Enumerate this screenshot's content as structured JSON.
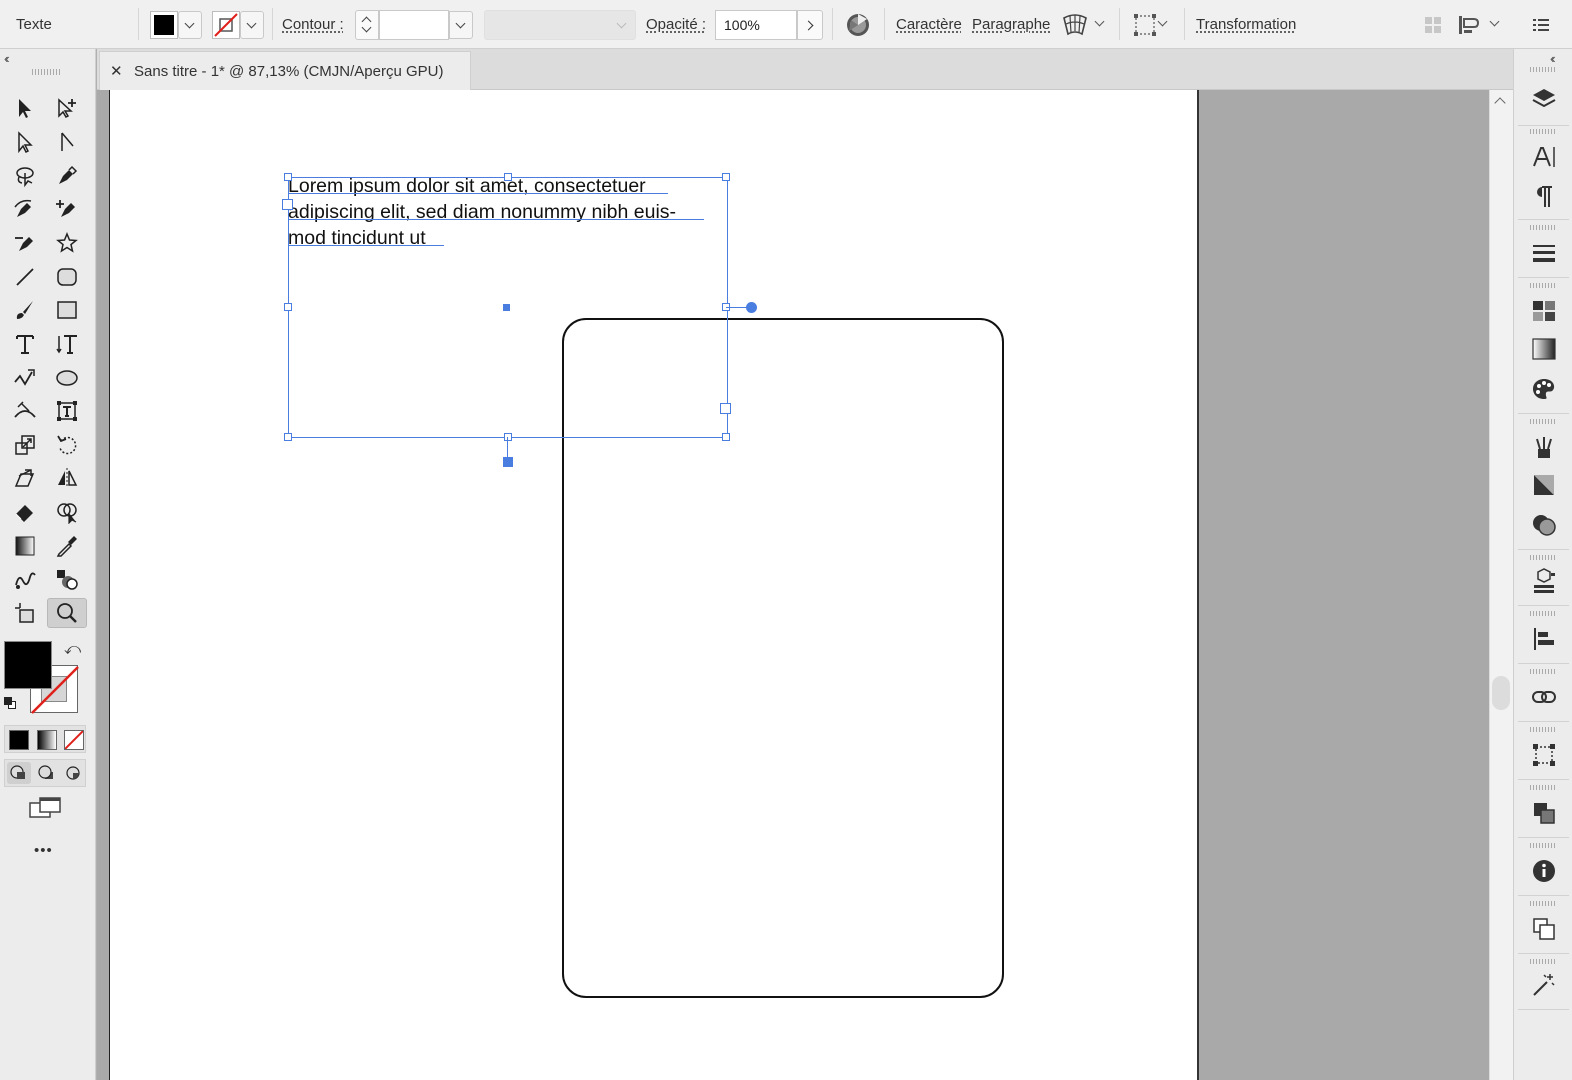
{
  "control_bar": {
    "mode_label": "Texte",
    "stroke_label": "Contour :",
    "stroke_value": "",
    "opacity_label": "Opacité :",
    "opacity_value": "100%",
    "character_link": "Caractère",
    "paragraph_link": "Paragraphe",
    "transform_link": "Transformation",
    "fill_color": "#000000"
  },
  "document": {
    "tab_close": "✕",
    "tab_title": "Sans titre - 1* @ 87,13% (CMJN/Aperçu GPU)",
    "text_lines": [
      "Lorem ipsum dolor sit amet, consectetuer",
      "adipiscing elit, sed diam nonummy nibh euis-",
      "mod tincidunt ut"
    ],
    "selection_color": "#4a7de0"
  },
  "left_toolbar": {
    "collapse": "‹‹",
    "more_tools": "•••",
    "tools": [
      "selection-tool",
      "direct-selection-tool",
      "anchor-select-tool",
      "anchor-corner-tool",
      "lasso-tool",
      "pen-tool",
      "curvature-tool",
      "add-anchor-tool",
      "anchor-point-tool",
      "star-tool",
      "line-segment-tool",
      "rounded-rectangle-tool",
      "paintbrush-tool",
      "rectangle-tool",
      "type-tool",
      "vertical-type-tool",
      "shaper-tool",
      "ellipse-tool",
      "width-tool",
      "free-transform-tool",
      "scale-tool",
      "rotate-tool",
      "shear-tool",
      "reflect-tool",
      "eraser-tool",
      "shape-builder-tool",
      "gradient-tool",
      "eyedropper-tool",
      "blend-tool",
      "symbol-sprayer-tool",
      "artboard-tool",
      "zoom-tool"
    ]
  },
  "right_dock": {
    "collapse": "‹‹",
    "panels": [
      "layers-icon",
      "character-icon",
      "paragraph-icon",
      "stroke-icon",
      "swatches-icon",
      "gradient-icon",
      "color-guide-icon",
      "brushes-icon",
      "transparency-icon",
      "appearance-icon",
      "asset-export-icon",
      "align-icon",
      "links-icon",
      "transform-icon",
      "pathfinder-icon",
      "info-icon",
      "artboards-icon",
      "magic-wand-icon"
    ]
  }
}
